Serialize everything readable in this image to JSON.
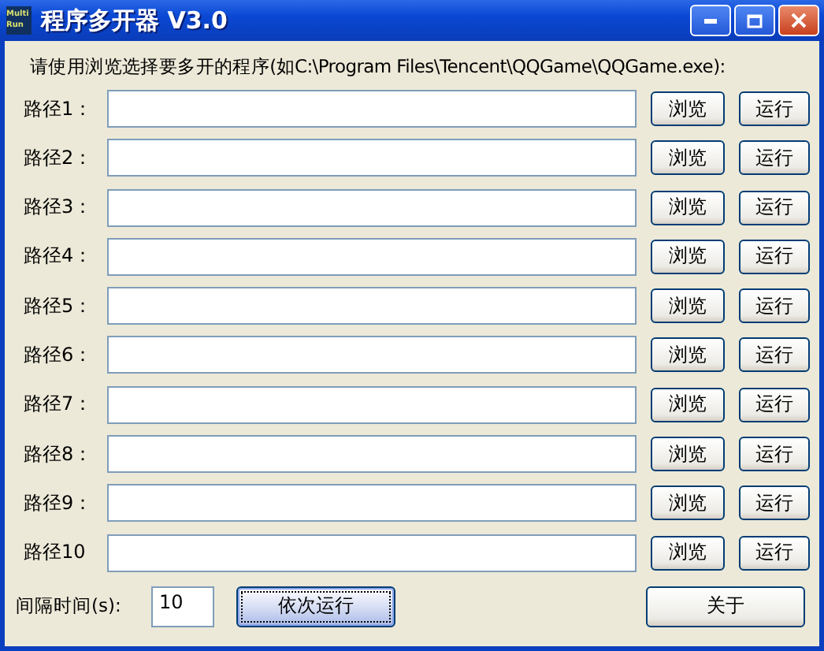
{
  "window": {
    "title": "程序多开器 V3.0",
    "logo_text": [
      "Multi",
      "Run"
    ],
    "controls": [
      {
        "kind": "minimize"
      },
      {
        "kind": "maximize"
      },
      {
        "kind": "close"
      }
    ]
  },
  "instruction": "请使用浏览选择要多开的程序(如C:\\Program Files\\Tencent\\QQGame\\QQGame.exe):",
  "paths": [
    {
      "label": "路径1：",
      "browse": "浏览",
      "run": "运行"
    },
    {
      "label": "路径2：",
      "browse": "浏览",
      "run": "运行"
    },
    {
      "label": "路径3：",
      "browse": "浏览",
      "run": "运行"
    },
    {
      "label": "路径4：",
      "browse": "浏览",
      "run": "运行"
    },
    {
      "label": "路径5：",
      "browse": "浏览",
      "run": "运行"
    },
    {
      "label": "路径6：",
      "browse": "浏览",
      "run": "运行"
    },
    {
      "label": "路径7：",
      "browse": "浏览",
      "run": "运行"
    },
    {
      "label": "路径8：",
      "browse": "浏览",
      "run": "运行"
    },
    {
      "label": "路径9：",
      "browse": "浏览",
      "run": "运行"
    },
    {
      "label": "路径10",
      "browse": "浏览",
      "run": "运行"
    }
  ],
  "interval": {
    "label": "间隔时间(s):",
    "value": "10"
  },
  "run_all_button": {
    "label": "依次运行",
    "focused": true
  },
  "about_button": {
    "label": "关于",
    "focused": false
  }
}
